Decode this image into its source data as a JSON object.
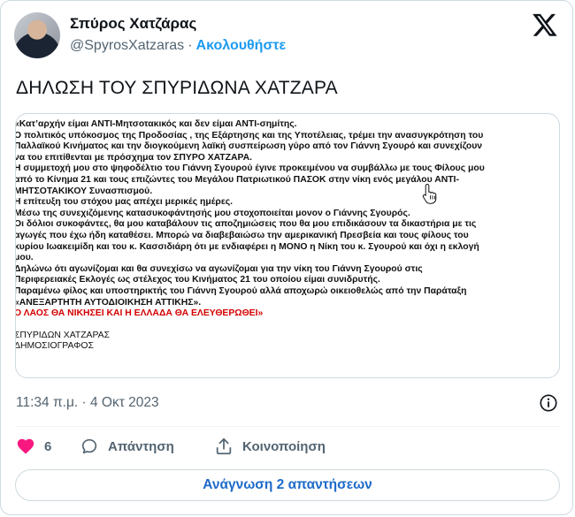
{
  "author": {
    "name": "Σπύρος Χατζάρας",
    "handle": "@SpyrosXatzaras",
    "separator": "·",
    "follow_label": "Ακολουθήστε"
  },
  "tweet": {
    "text": "ΔΗΛΩΣΗ ΤΟΥ ΣΠΥΡΙΔΩΝΑ ΧΑΤΖΑΡΑ",
    "document_lines": [
      {
        "text": "«Κατ’αρχήν είμαι ΑΝΤΙ-Μητσοτακικός και δεν είμαι ΑΝΤΙ-σημίτης.",
        "style": "bold"
      },
      {
        "text": "Ο πολιτικός υπόκοσμος της Προδοσίας , της Εξάρτησης και της Υποτέλειας, τρέμει την ανασυγκρότηση του",
        "style": "bold"
      },
      {
        "text": "Παλλαϊκού Κινήματος και την διογκούμενη λαϊκή συσπείρωση γύρο από τον Γιάννη Σγουρό και συνεχίζουν",
        "style": "bold"
      },
      {
        "text": "να του επιτίθενται με πρόσχημα τον ΣΠΥΡΟ ΧΑΤΖΑΡΑ.",
        "style": "bold"
      },
      {
        "text": "Η συμμετοχή μου στο ψηφοδέλτιο του  Γιάννη Σγουρού έγινε  προκειμένου να συμβάλλω με τους Φίλους μου",
        "style": "bold"
      },
      {
        "text": "από το Κίνημα 21 και τους επιζώντες του Μεγάλου Πατριωτικού  ΠΑΣΟΚ στην νίκη ενός μεγάλου ΑΝΤΙ-",
        "style": "bold"
      },
      {
        "text": "ΜΗΤΣΟΤΑΚΙΚΟΥ Συνασπισμού.",
        "style": "bold"
      },
      {
        "text": "Η επίτευξη του   στόχου μας απέχει μερικές ημέρες.",
        "style": "bold"
      },
      {
        "text": "Μέσω της συνεχιζόμενης κατασυκοφάντησής μου στοχοποιείται μονον ο  Γιάννης Σγουρός.",
        "style": "bold"
      },
      {
        "text": "Οι δόλιοι συκοφάντες, θα μου καταβάλουν τις αποζημιώσεις  που θα μου επιδικάσουν τα δικαστήρια με τις",
        "style": "bold"
      },
      {
        "text": "αγωγές που έχω ήδη καταθέσει. Μπορώ να διαβεβαιώσω την αμερικανική Πρεσβεία και  τους φίλους του",
        "style": "bold"
      },
      {
        "text": "κυρίου Ιωακειμίδη  και του κ. Κασσιδιάρη ότι με ενδιαφέρει η ΜΟΝΟ η Νίκη του κ. Σγουρού και όχι η εκλογή",
        "style": "bold"
      },
      {
        "text": "μου.",
        "style": "bold"
      },
      {
        "text": "Δηλώνω ότι αγωνίζομαι  και θα συνεχίσω να αγωνίζομαι για την νίκη του Γιάννη Σγουρού στις",
        "style": "bold"
      },
      {
        "text": "Περιφερειακές Εκλογές ως στέλεχος του Κινήματος 21 του οποίου είμαι συνιδρυτής.",
        "style": "bold"
      },
      {
        "text": "Παραμένω φίλος και υποστηρικτής του Γιάννη Σγουρού αλλά αποχωρώ οικειοθελώς από την Παράταξη",
        "style": "bold"
      },
      {
        "text": "«ΑΝΕΞΑΡΤΗΤΗ ΑΥΤΟΔΙΟΙΚΗΣΗ ΑΤΤΙΚΗΣ».",
        "style": "bold"
      },
      {
        "text": "Ο ΛΑΟΣ ΘΑ ΝΙΚΗΣΕΙ ΚΑΙ Η ΕΛΛΑΔΑ ΘΑ ΕΛΕΥΘΕΡΩΘΕΙ»",
        "style": "red"
      },
      {
        "text": "ΣΠΥΡΙΔΩΝ ΧΑΤΖΑΡΑΣ",
        "style": "plain gap"
      },
      {
        "text": "ΔΗΜΟΣΙΟΓΡΑΦΟΣ",
        "style": "plain"
      }
    ],
    "time": "11:34 π.μ.",
    "date_separator": "·",
    "date": "4 Οκτ 2023"
  },
  "actions": {
    "like_count": "6",
    "reply_label": "Απάντηση",
    "share_label": "Κοινοποίηση"
  },
  "read_replies_label": "Ανάγνωση 2 απαντήσεων",
  "colors": {
    "accent": "#1d9bf0",
    "like": "#f91880",
    "muted": "#536471",
    "highlight_red": "#d40000"
  },
  "icons": [
    "x-logo-icon",
    "heart-icon",
    "reply-icon",
    "share-icon",
    "info-icon",
    "hand-cursor-icon"
  ]
}
